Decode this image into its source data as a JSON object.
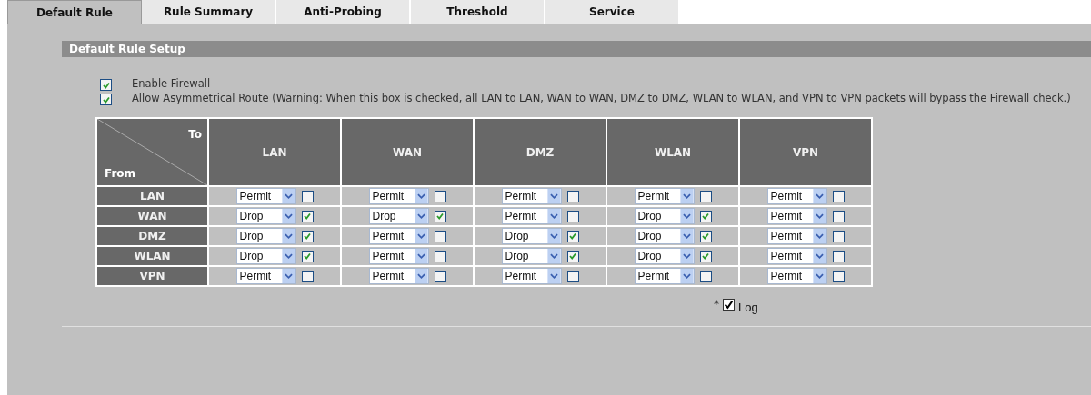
{
  "tabs": [
    {
      "label": "Default Rule",
      "selected": true
    },
    {
      "label": "Rule Summary",
      "selected": false
    },
    {
      "label": "Anti-Probing",
      "selected": false
    },
    {
      "label": "Threshold",
      "selected": false
    },
    {
      "label": "Service",
      "selected": false
    }
  ],
  "section_title": "Default Rule Setup",
  "options": [
    {
      "label": "Enable Firewall",
      "checked": true
    },
    {
      "label": "Allow Asymmetrical Route (Warning: When this box is checked, all LAN to LAN, WAN to WAN, DMZ to DMZ, WLAN to WLAN, and VPN to VPN packets will bypass the Firewall check.)",
      "checked": true
    }
  ],
  "table": {
    "corner_to": "To",
    "corner_from": "From",
    "columns": [
      "LAN",
      "WAN",
      "DMZ",
      "WLAN",
      "VPN"
    ],
    "rows": [
      {
        "from": "LAN",
        "cells": [
          {
            "action": "Permit",
            "log": false
          },
          {
            "action": "Permit",
            "log": false
          },
          {
            "action": "Permit",
            "log": false
          },
          {
            "action": "Permit",
            "log": false
          },
          {
            "action": "Permit",
            "log": false
          }
        ]
      },
      {
        "from": "WAN",
        "cells": [
          {
            "action": "Drop",
            "log": true
          },
          {
            "action": "Drop",
            "log": true
          },
          {
            "action": "Permit",
            "log": false
          },
          {
            "action": "Drop",
            "log": true
          },
          {
            "action": "Permit",
            "log": false
          }
        ]
      },
      {
        "from": "DMZ",
        "cells": [
          {
            "action": "Drop",
            "log": true
          },
          {
            "action": "Permit",
            "log": false
          },
          {
            "action": "Drop",
            "log": true
          },
          {
            "action": "Drop",
            "log": true
          },
          {
            "action": "Permit",
            "log": false
          }
        ]
      },
      {
        "from": "WLAN",
        "cells": [
          {
            "action": "Drop",
            "log": true
          },
          {
            "action": "Permit",
            "log": false
          },
          {
            "action": "Drop",
            "log": true
          },
          {
            "action": "Drop",
            "log": true
          },
          {
            "action": "Permit",
            "log": false
          }
        ]
      },
      {
        "from": "VPN",
        "cells": [
          {
            "action": "Permit",
            "log": false
          },
          {
            "action": "Permit",
            "log": false
          },
          {
            "action": "Permit",
            "log": false
          },
          {
            "action": "Permit",
            "log": false
          },
          {
            "action": "Permit",
            "log": false
          }
        ]
      }
    ]
  },
  "legend": {
    "mark": "*",
    "checked": true,
    "label": "Log"
  }
}
